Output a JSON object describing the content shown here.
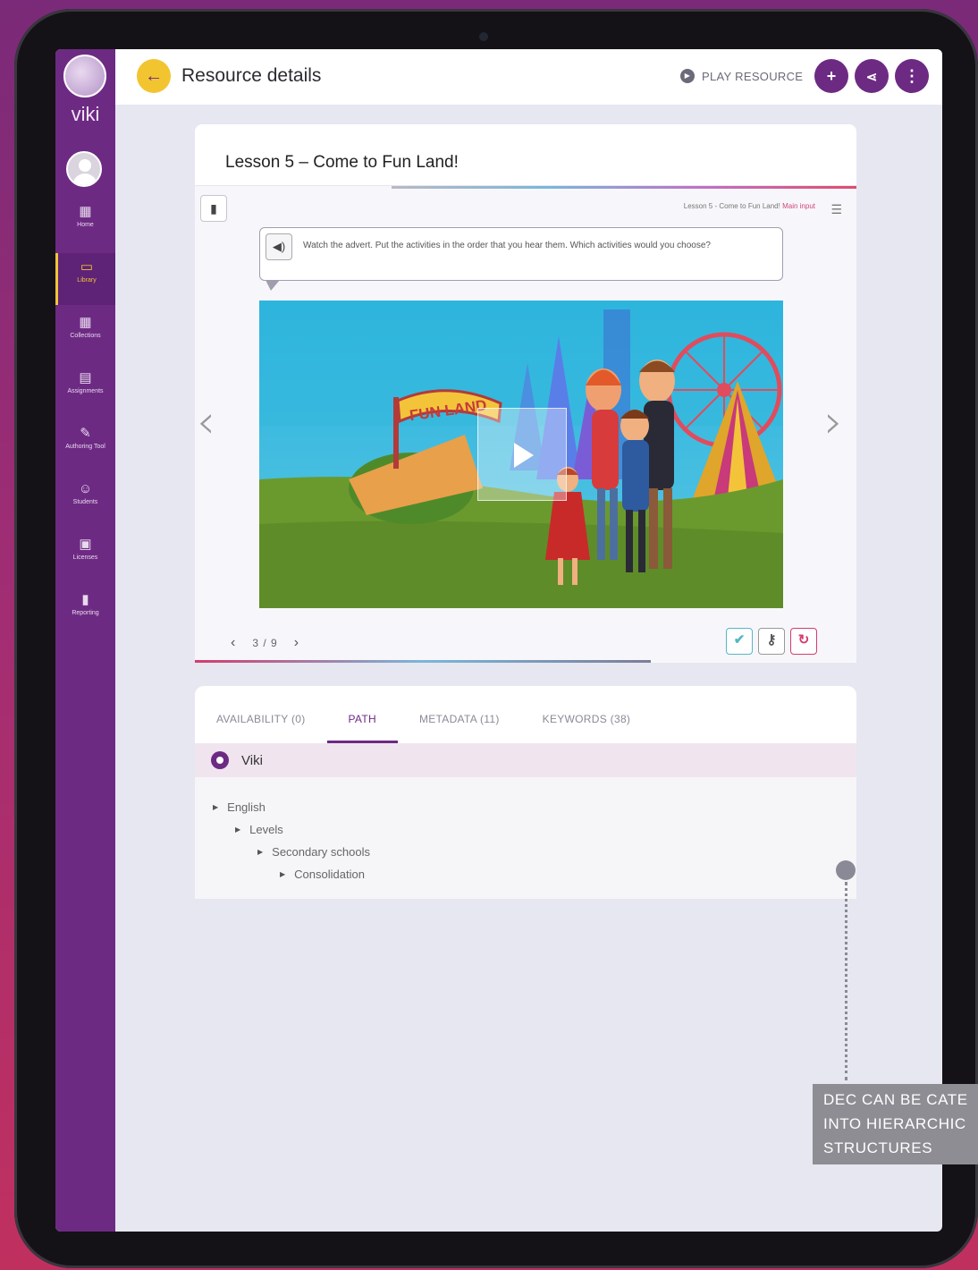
{
  "sidebar": {
    "brand": "viki",
    "items": [
      {
        "label": "Home",
        "icon": "home-icon",
        "glyph": "▦"
      },
      {
        "label": "Library",
        "icon": "library-icon",
        "glyph": "▭",
        "active": true
      },
      {
        "label": "Collections",
        "icon": "collections-icon",
        "glyph": "▦"
      },
      {
        "label": "Assignments",
        "icon": "assignments-icon",
        "glyph": "▤"
      },
      {
        "label": "Authoring Tool",
        "icon": "palette-icon",
        "glyph": "✎"
      },
      {
        "label": "Students",
        "icon": "students-icon",
        "glyph": "☺"
      },
      {
        "label": "Licenses",
        "icon": "licenses-icon",
        "glyph": "▣"
      },
      {
        "label": "Reporting",
        "icon": "reporting-icon",
        "glyph": "▮"
      }
    ],
    "accent": "#6d2a83",
    "active_color": "#f3c43a"
  },
  "header": {
    "title": "Resource details",
    "play_label": "PLAY RESOURCE",
    "actions": [
      "add-icon",
      "share-icon",
      "more-icon"
    ]
  },
  "lesson": {
    "title": "Lesson 5 – Come to Fun Land!",
    "breadcrumb": "Lesson 5 - Come to Fun Land!",
    "breadcrumb_link": "Main input",
    "instruction": "Watch the advert. Put the activities in the order that you hear them. Which activities would you choose?",
    "sign_text": "FUN LAND",
    "pager": "3 / 9"
  },
  "tabs": [
    {
      "label": "AVAILABILITY (0)",
      "active": false
    },
    {
      "label": "PATH",
      "active": true
    },
    {
      "label": "METADATA (11)",
      "active": false
    },
    {
      "label": "KEYWORDS (38)",
      "active": false
    }
  ],
  "path": {
    "root": "Viki",
    "tree": [
      "English",
      "Levels",
      "Secondary schools",
      "Consolidation"
    ]
  },
  "annotation": {
    "lines": [
      "DEC CAN BE CATE",
      "INTO HIERARCHIC",
      "STRUCTURES"
    ]
  }
}
